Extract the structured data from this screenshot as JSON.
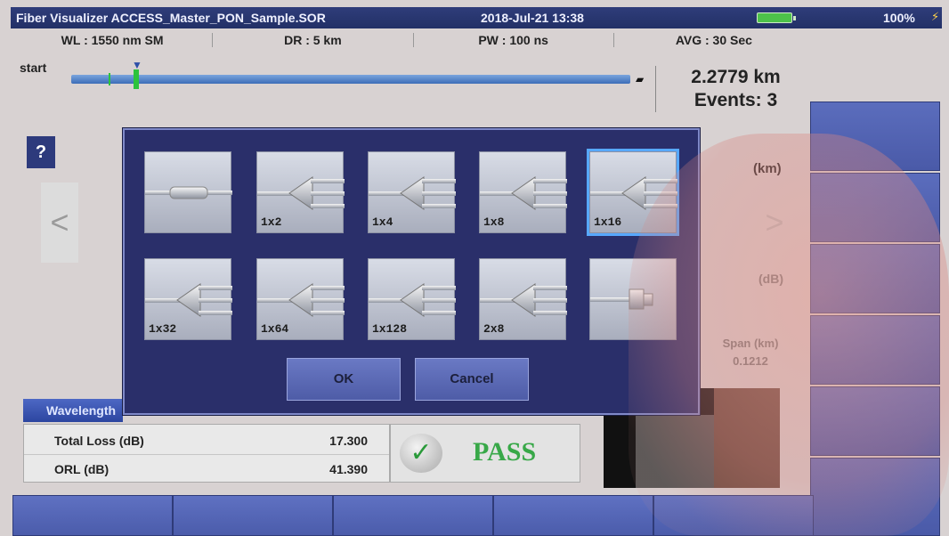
{
  "titlebar": {
    "title": "Fiber Visualizer ACCESS_Master_PON_Sample.SOR",
    "datetime": "2018-Jul-21 13:38",
    "battery_percent": "100%"
  },
  "info": {
    "wl": "WL : 1550 nm SM",
    "dr": "DR : 5 km",
    "pw": "PW : 100 ns",
    "avg": "AVG : 30 Sec"
  },
  "trace": {
    "start_label": "start",
    "distance": "2.2779 km",
    "events": "Events: 3"
  },
  "background": {
    "help_label": "?",
    "prev_arrow": "<",
    "next_arrow": ">",
    "unit_km": "(km)",
    "unit_db": "(dB)",
    "span_label": "Span (km)",
    "span_value": "0.1212",
    "wavelength_tab": "Wavelength"
  },
  "results": {
    "total_loss_label": "Total Loss (dB)",
    "total_loss_value": "17.300",
    "orl_label": "ORL (dB)",
    "orl_value": "41.390",
    "status": "PASS"
  },
  "dialog": {
    "tiles": [
      {
        "label": "",
        "icon": "connector-icon"
      },
      {
        "label": "1x2",
        "icon": "splitter-icon"
      },
      {
        "label": "1x4",
        "icon": "splitter-icon"
      },
      {
        "label": "1x8",
        "icon": "splitter-icon"
      },
      {
        "label": "1x16",
        "icon": "splitter-icon",
        "selected": true
      },
      {
        "label": "1x32",
        "icon": "splitter-icon"
      },
      {
        "label": "1x64",
        "icon": "splitter-icon"
      },
      {
        "label": "1x128",
        "icon": "splitter-icon"
      },
      {
        "label": "2x8",
        "icon": "splitter-icon"
      },
      {
        "label": "",
        "icon": "end-connector-icon"
      }
    ],
    "ok_label": "OK",
    "cancel_label": "Cancel"
  },
  "colors": {
    "dialog_bg": "#2a2f6a",
    "accent_blue": "#4a5aa8",
    "selection": "#57a8ff",
    "pass_green": "#38a848"
  }
}
